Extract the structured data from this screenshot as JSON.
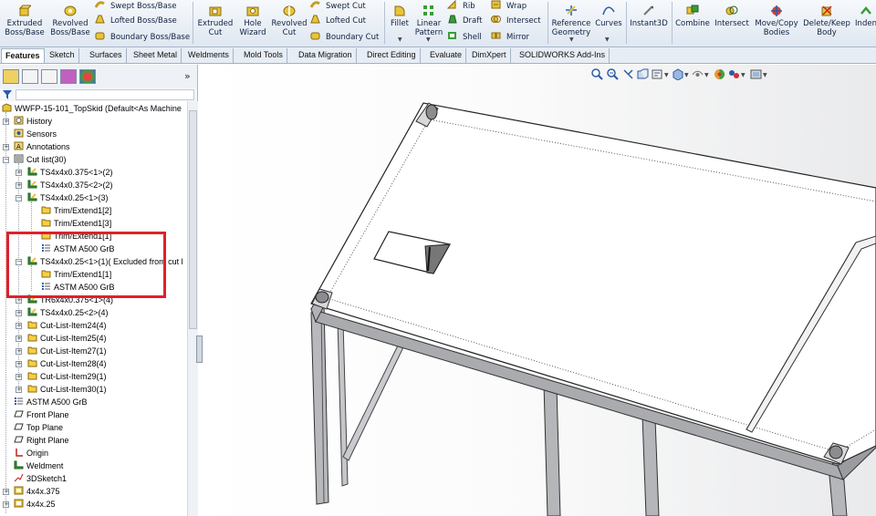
{
  "ribbon": {
    "features": [
      {
        "label": "Extruded\nBoss/Base",
        "icon": "extruded-boss-icon"
      },
      {
        "label": "Revolved\nBoss/Base",
        "icon": "revolved-boss-icon"
      },
      {
        "label": "Swept Boss/Base",
        "icon": "swept-boss-icon"
      },
      {
        "label": "Lofted Boss/Base",
        "icon": "lofted-boss-icon"
      },
      {
        "label": "Boundary Boss/Base",
        "icon": "boundary-boss-icon"
      },
      {
        "label": "Extruded\nCut",
        "icon": "extruded-cut-icon"
      },
      {
        "label": "Hole\nWizard",
        "icon": "hole-wizard-icon"
      },
      {
        "label": "Revolved\nCut",
        "icon": "revolved-cut-icon"
      },
      {
        "label": "Swept Cut",
        "icon": "swept-cut-icon"
      },
      {
        "label": "Lofted Cut",
        "icon": "lofted-cut-icon"
      },
      {
        "label": "Boundary Cut",
        "icon": "boundary-cut-icon"
      },
      {
        "label": "Fillet",
        "icon": "fillet-icon"
      },
      {
        "label": "Linear\nPattern",
        "icon": "linear-pattern-icon"
      },
      {
        "label": "Rib",
        "icon": "rib-icon"
      },
      {
        "label": "Draft",
        "icon": "draft-icon"
      },
      {
        "label": "Shell",
        "icon": "shell-icon"
      },
      {
        "label": "Wrap",
        "icon": "wrap-icon"
      },
      {
        "label": "Intersect",
        "icon": "intersect-icon"
      },
      {
        "label": "Mirror",
        "icon": "mirror-icon"
      },
      {
        "label": "Reference\nGeometry",
        "icon": "reference-geometry-icon"
      },
      {
        "label": "Curves",
        "icon": "curves-icon"
      },
      {
        "label": "Instant3D",
        "icon": "instant3d-icon"
      },
      {
        "label": "Combine",
        "icon": "combine-icon"
      },
      {
        "label": "Intersect",
        "icon": "intersect-body-icon"
      },
      {
        "label": "Move/Copy\nBodies",
        "icon": "move-copy-icon"
      },
      {
        "label": "Delete/Keep\nBody",
        "icon": "delete-keep-icon"
      },
      {
        "label": "Inden",
        "icon": "indent-icon"
      }
    ]
  },
  "tabs": [
    "Features",
    "Sketch",
    "Surfaces",
    "Sheet Metal",
    "Weldments",
    "Mold Tools",
    "Data Migration",
    "Direct Editing",
    "Evaluate",
    "DimXpert",
    "SOLIDWORKS Add-Ins"
  ],
  "tree": {
    "root": "WWFP-15-101_TopSkid  (Default<As Machine",
    "items": [
      {
        "label": "History",
        "icon": "history-icon"
      },
      {
        "label": "Sensors",
        "icon": "sensors-icon"
      },
      {
        "label": "Annotations",
        "icon": "annotations-icon"
      },
      {
        "label": "Cut list(30)",
        "icon": "cut-list-icon"
      },
      {
        "label": "TS4x4x0.375<1>(2)",
        "icon": "weldment-member-icon"
      },
      {
        "label": "TS4x4x0.375<2>(2)",
        "icon": "weldment-member-icon"
      },
      {
        "label": "TS4x4x0.25<1>(3)",
        "icon": "weldment-member-icon"
      },
      {
        "label": "Trim/Extend1[2]",
        "icon": "body-icon"
      },
      {
        "label": "Trim/Extend1[3]",
        "icon": "body-icon"
      },
      {
        "label": "Trim/Extend1[1]",
        "icon": "body-icon"
      },
      {
        "label": "ASTM A500 GrB",
        "icon": "material-icon"
      },
      {
        "label": "TS4x4x0.25<1>(1)( Excluded from cut l",
        "icon": "weldment-member-icon"
      },
      {
        "label": "Trim/Extend1[1]",
        "icon": "body-icon"
      },
      {
        "label": "ASTM A500 GrB",
        "icon": "material-icon"
      },
      {
        "label": "TR6x4x0.375<1>(4)",
        "icon": "weldment-member-icon"
      },
      {
        "label": "TS4x4x0.25<2>(4)",
        "icon": "weldment-member-icon"
      },
      {
        "label": "Cut-List-Item24(4)",
        "icon": "folder-icon"
      },
      {
        "label": "Cut-List-Item25(4)",
        "icon": "folder-icon"
      },
      {
        "label": "Cut-List-Item27(1)",
        "icon": "folder-icon"
      },
      {
        "label": "Cut-List-Item28(4)",
        "icon": "folder-icon"
      },
      {
        "label": "Cut-List-Item29(1)",
        "icon": "folder-icon"
      },
      {
        "label": "Cut-List-Item30(1)",
        "icon": "folder-icon"
      },
      {
        "label": "ASTM A500 GrB",
        "icon": "material-icon"
      },
      {
        "label": "Front Plane",
        "icon": "plane-icon"
      },
      {
        "label": "Top Plane",
        "icon": "plane-icon"
      },
      {
        "label": "Right Plane",
        "icon": "plane-icon"
      },
      {
        "label": "Origin",
        "icon": "origin-icon"
      },
      {
        "label": "Weldment",
        "icon": "weldment-icon"
      },
      {
        "label": "3DSketch1",
        "icon": "sketch3d-icon"
      },
      {
        "label": "4x4x.375",
        "icon": "structural-member-icon"
      },
      {
        "label": "4x4x.25",
        "icon": "structural-member-icon"
      }
    ]
  },
  "colors": {
    "highlight": "#e0202a",
    "ribbon_bg": "#e7edf5",
    "accent": "#2a5da8"
  }
}
